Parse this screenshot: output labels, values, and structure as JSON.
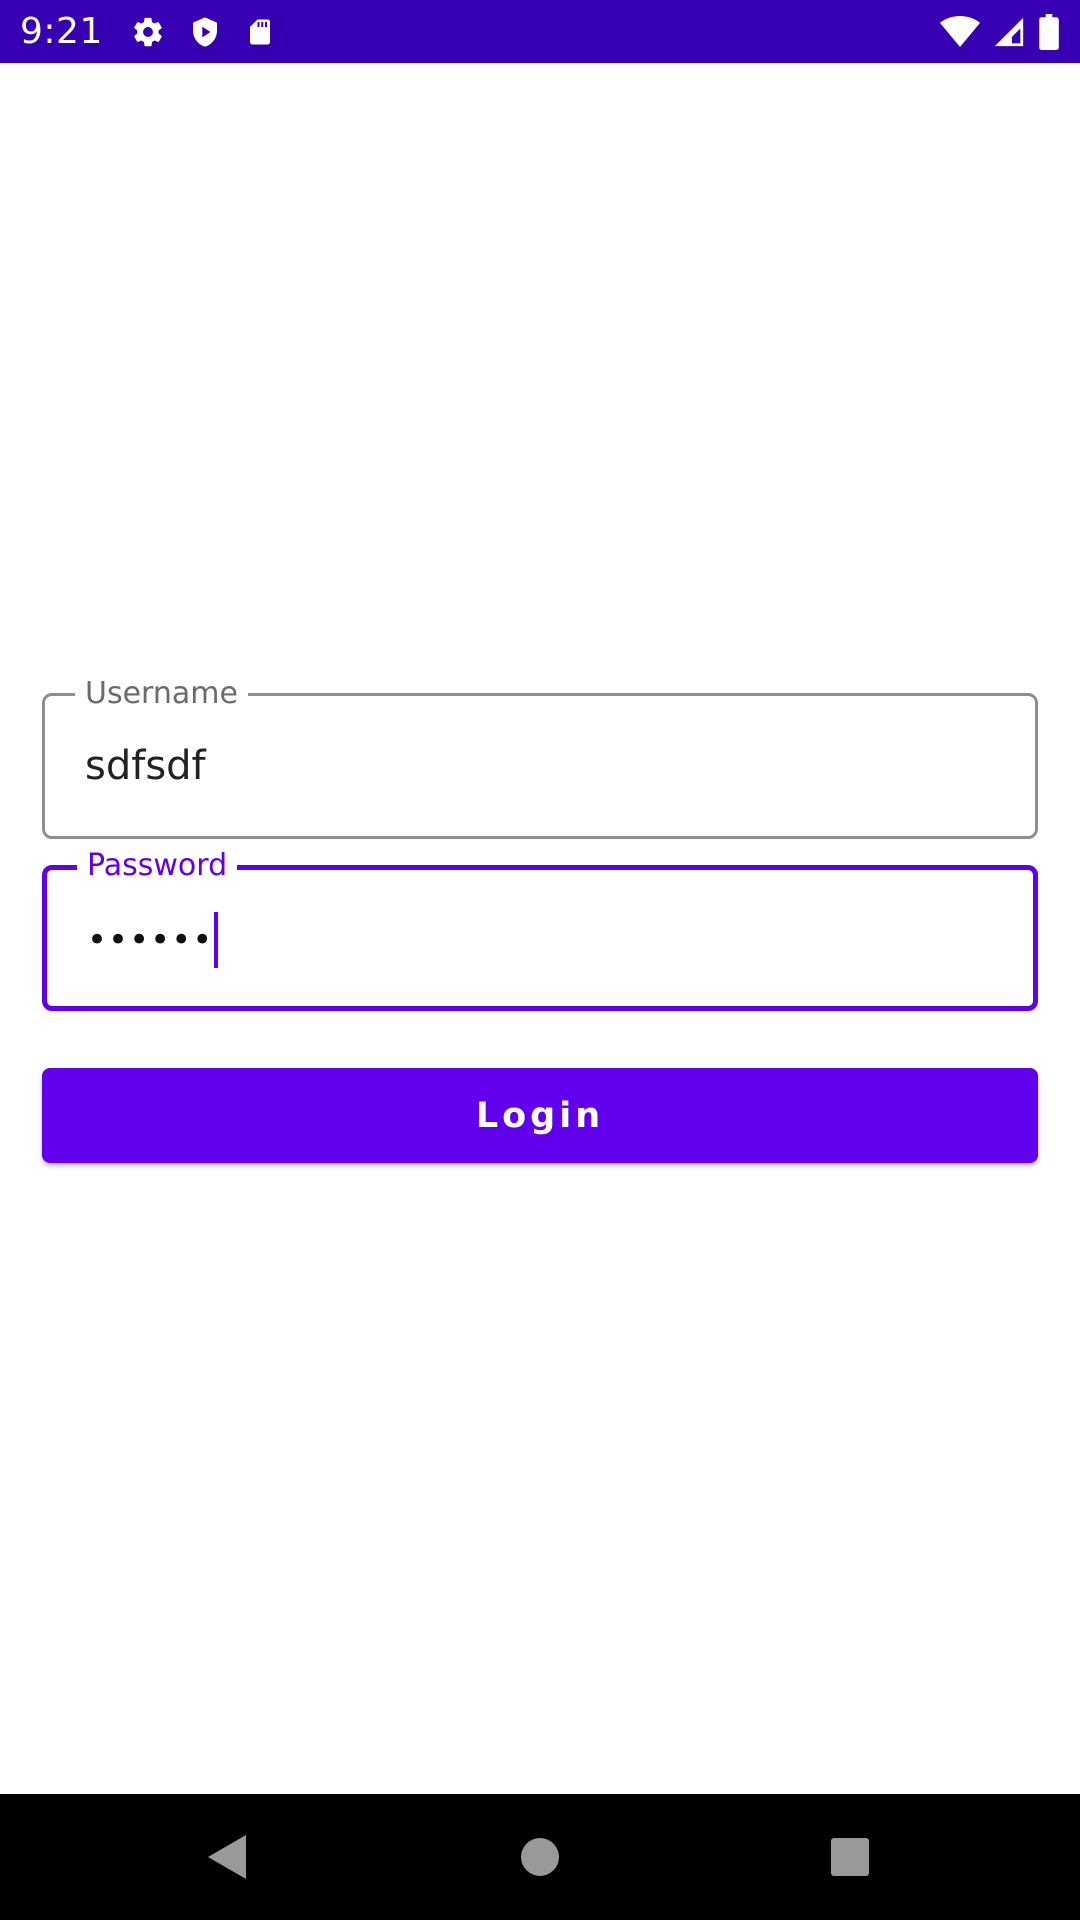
{
  "status_bar": {
    "time": "9:21",
    "background": "#3700b3",
    "left_icons": [
      "gear-icon",
      "shield-play-icon",
      "sd-card-icon"
    ],
    "right_icons": [
      "wifi-icon",
      "cell-signal-icon",
      "battery-icon"
    ]
  },
  "form": {
    "username": {
      "label": "Username",
      "value": "sdfsdf"
    },
    "password": {
      "label": "Password",
      "masked_value": "••••••",
      "focused": true
    },
    "login_button": {
      "label": "Login"
    }
  },
  "colors": {
    "accent": "#6200ee",
    "status_bar": "#3700b3",
    "outline": "#8e8e8e"
  },
  "nav_bar": {
    "buttons": [
      "back-icon",
      "home-icon",
      "recents-icon"
    ]
  }
}
